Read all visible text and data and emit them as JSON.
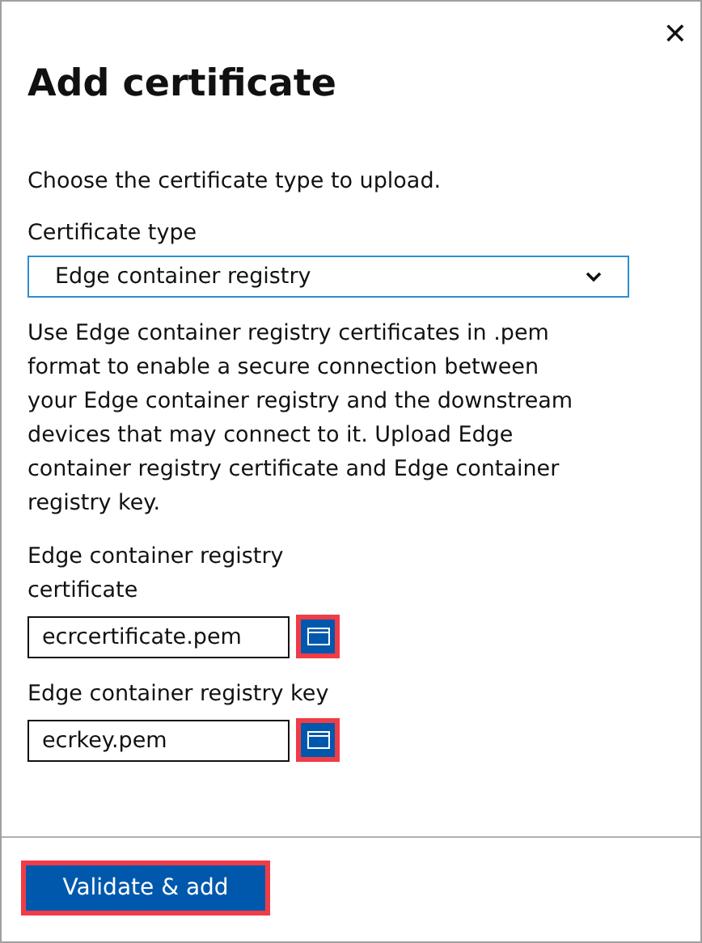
{
  "close_button": {
    "label": "✕"
  },
  "title": "Add certificate",
  "intro": "Choose the certificate type to upload.",
  "certificate_type": {
    "label": "Certificate type",
    "value": "Edge container registry"
  },
  "description": "Use Edge container registry certificates in .pem format to enable a secure connection between your Edge container registry and the downstream devices that may connect to it. Upload Edge container registry certificate and Edge container registry key.",
  "files": [
    {
      "label": "Edge container registry certificate",
      "value": "ecrcertificate.pem",
      "highlighted": true
    },
    {
      "label": "Edge container registry key",
      "value": "ecrkey.pem",
      "highlighted": true
    }
  ],
  "submit_button": {
    "label": "Validate & add",
    "highlighted": true
  }
}
